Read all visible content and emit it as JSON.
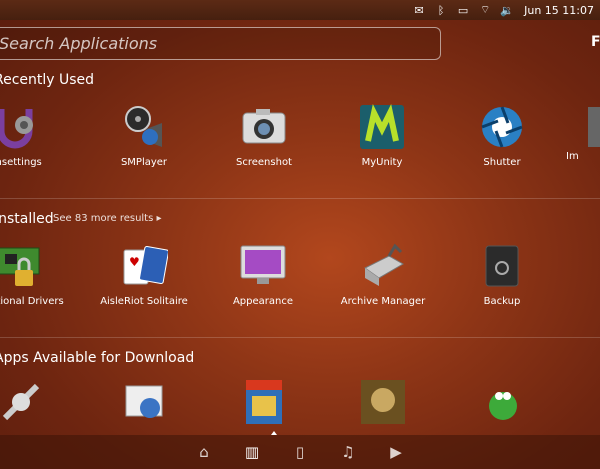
{
  "topbar": {
    "clock": "Jun 15 11:07",
    "indicators": [
      "mail-icon",
      "bluetooth-icon",
      "battery-icon",
      "wifi-icon",
      "volume-icon"
    ]
  },
  "search": {
    "placeholder": "Search Applications",
    "right_label": "F"
  },
  "sections": {
    "recent": {
      "title": "Recently Used"
    },
    "installed": {
      "title": "Installed",
      "more": "See 83 more results ▸"
    },
    "download": {
      "title": "Apps Available for Download"
    }
  },
  "recent": [
    {
      "label": "Unsettings",
      "icon": "unsettings-icon"
    },
    {
      "label": "SMPlayer",
      "icon": "smplayer-icon"
    },
    {
      "label": "Screenshot",
      "icon": "camera-icon"
    },
    {
      "label": "MyUnity",
      "icon": "myunity-icon"
    },
    {
      "label": "Shutter",
      "icon": "shutter-icon"
    },
    {
      "label": "Im",
      "icon": "image-icon"
    }
  ],
  "installed": [
    {
      "label": "Additional Drivers",
      "icon": "drivers-icon"
    },
    {
      "label": "AisleRiot Solitaire",
      "icon": "cards-icon"
    },
    {
      "label": "Appearance",
      "icon": "appearance-icon"
    },
    {
      "label": "Archive Manager",
      "icon": "archive-icon"
    },
    {
      "label": "Backup",
      "icon": "backup-icon"
    }
  ],
  "dock": [
    "home-icon",
    "apps-icon",
    "files-icon",
    "music-icon",
    "video-icon"
  ],
  "colors": {
    "accent": "#ffffff",
    "background": "#8e3516"
  }
}
